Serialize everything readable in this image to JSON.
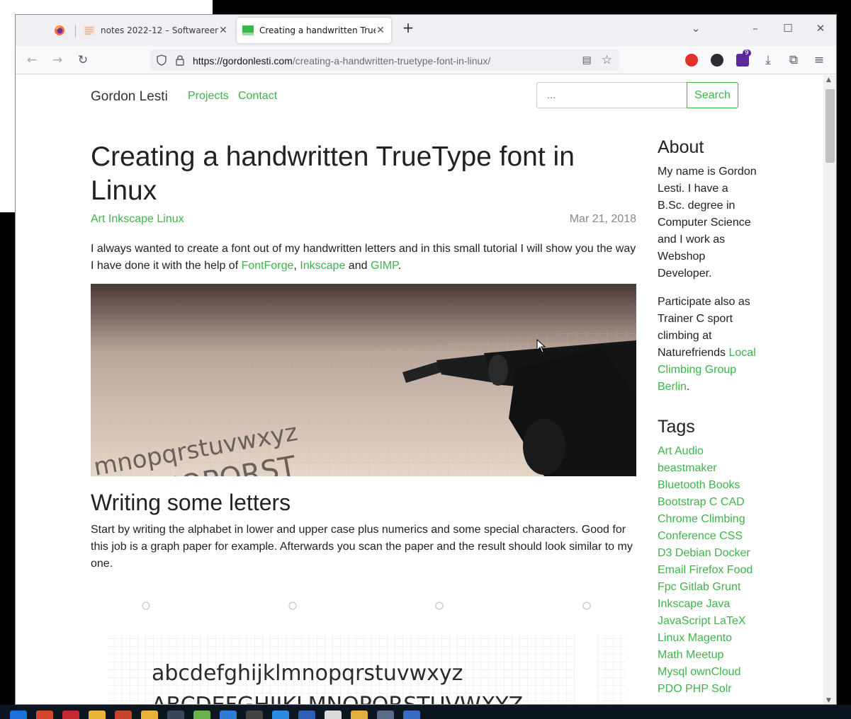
{
  "browser": {
    "tabs": [
      {
        "label": ""
      },
      {
        "label": "notes 2022-12 – Softwareengel – "
      },
      {
        "label": "Creating a handwritten TrueType font in Linux"
      }
    ],
    "new_tab": "+",
    "url_host": "https://gordonlesti.com",
    "url_path": "/creating-a-handwritten-truetype-font-in-linux/",
    "extension_badge": "9"
  },
  "site": {
    "brand": "Gordon Lesti",
    "nav": {
      "projects": "Projects",
      "contact": "Contact"
    },
    "search": {
      "placeholder": "...",
      "button": "Search"
    }
  },
  "article": {
    "title": "Creating a handwritten TrueType font in Linux",
    "tags": "Art Inkscape Linux",
    "date": "Mar 21, 2018",
    "intro": {
      "text1": "I always wanted to create a font out of my handwritten letters and in this small tutorial I will show you the way I have done it with the help of ",
      "link1": "FontForge",
      "comma": ", ",
      "link2": "Inkscape",
      "and": " and ",
      "link3": "GIMP",
      "end": "."
    },
    "hero_letters_row1": "mnopqrstuvwxyz",
    "hero_letters_row2": "KLMNOPQRST",
    "hero_symbols": "(*!?!)",
    "section_heading": "Writing some letters",
    "section_text": "Start by writing the alphabet in lower and upper case plus numerics and some special characters. Good for this job is a graph paper for example. Afterwards you scan the paper and the result should look similar to my one.",
    "scan_lower": "abcdefghijklmnopqrstuvwxyz",
    "scan_upper": "ABCDEFGHIJKLMNOPQRSTUVWXYZ"
  },
  "sidebar": {
    "about_heading": "About",
    "about_text": "My name is Gordon Lesti. I have a B.Sc. degree in Computer Science and I work as Webshop Developer.",
    "participate_text": "Participate also as Trainer C sport climbing at Naturefriends ",
    "participate_link": "Local Climbing Group Berlin",
    "participate_end": ".",
    "tags_heading": "Tags",
    "tags": [
      "Art Audio",
      "beastmaker",
      "Bluetooth Books",
      "Bootstrap C CAD",
      "Chrome Climbing",
      "Conference CSS",
      "D3 Debian Docker",
      "Email Firefox Food",
      "Fpc Gitlab Grunt",
      "Inkscape Java",
      "JavaScript LaTeX",
      "Linux Magento",
      "Math Meetup",
      "Mysql ownCloud",
      "PDO PHP Solr"
    ]
  },
  "colors": {
    "link": "#3bb54a",
    "text": "#222222",
    "muted": "#888888"
  }
}
